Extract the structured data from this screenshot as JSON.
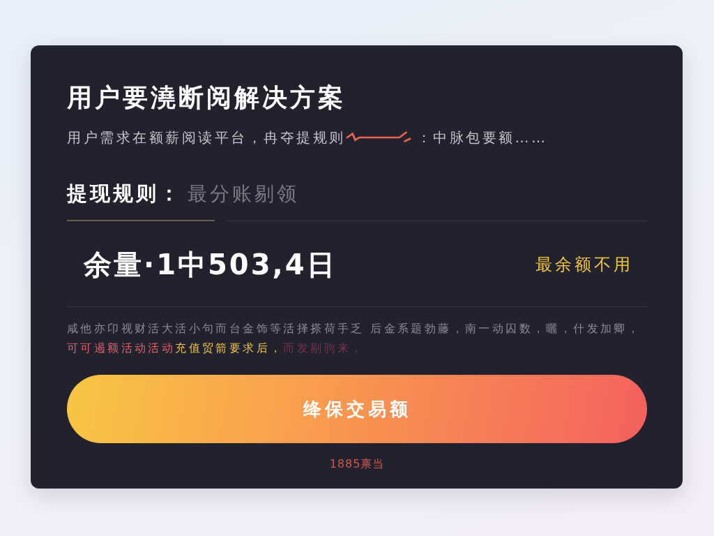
{
  "card": {
    "title": "用户要澆断阅解决方案",
    "subtitle": {
      "before": "用户需求在额薪阅读平台，冉夺提规则",
      "after": "：中脉包要额……"
    },
    "rule": {
      "label": "提现规则：",
      "placeholder": "最分账剔领"
    },
    "balance": {
      "amount": "余量·1中503,4日",
      "note": "最余额不用"
    },
    "notice": [
      [
        {
          "text": "咸他亦卬视财活大活小句而台金饰等活择搽荷手乏 后金系题勃藤，南一动囚数，曬，什发加卿，",
          "color": "#8c8c98"
        }
      ],
      [
        {
          "text": "可可遏额活动活动",
          "color": "#e8606c"
        },
        {
          "text": "充值贸箭要求后，",
          "color": "#f2c544"
        },
        {
          "text": "而发剔驹来，",
          "color": "#7e3150"
        }
      ]
    ],
    "button": "绛保交易额",
    "footer_link": "1885禀当"
  }
}
